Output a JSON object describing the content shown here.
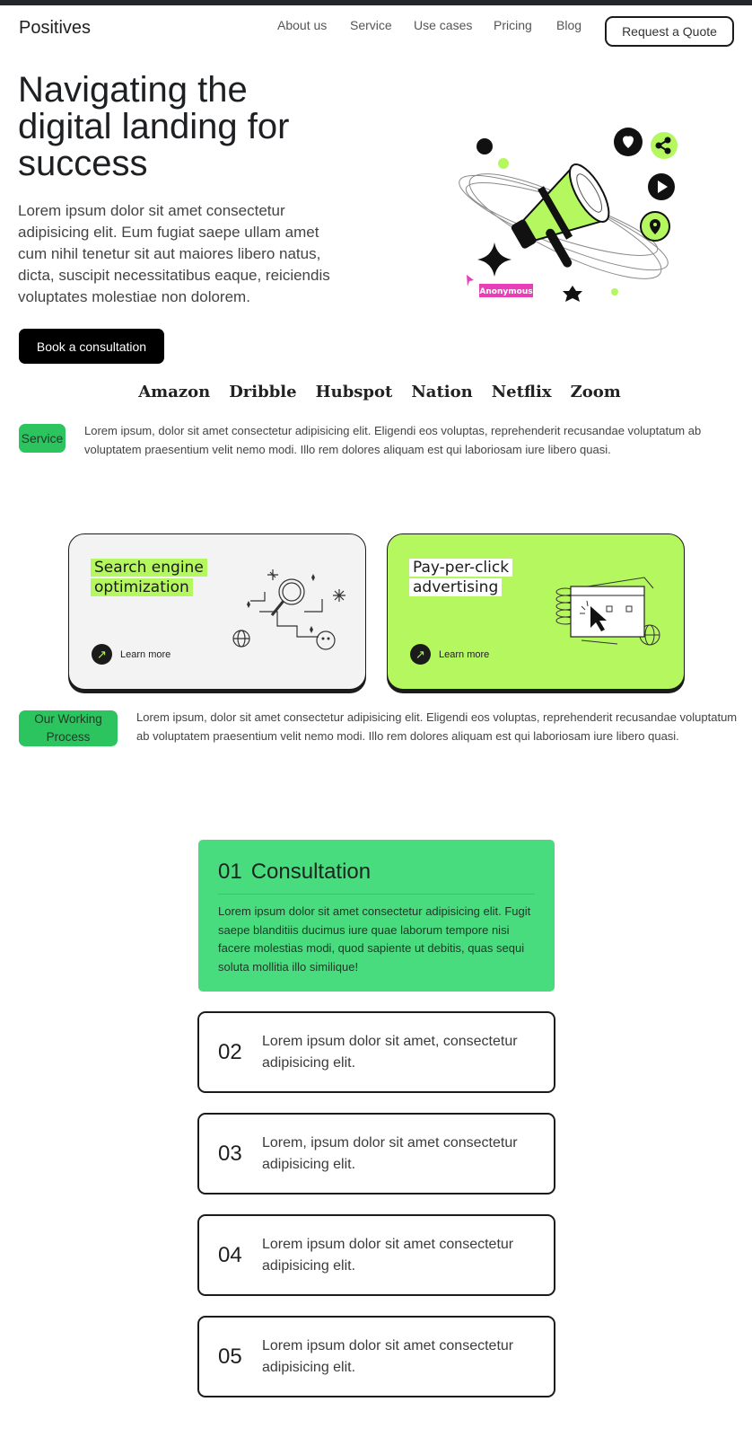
{
  "header": {
    "logo": "Positives",
    "nav": [
      "About us",
      "Service",
      "Use cases",
      "Pricing",
      "Blog"
    ],
    "cta": "Request a Quote"
  },
  "hero": {
    "title": "Navigating the digital landing for success",
    "text": "Lorem ipsum dolor sit amet consectetur adipisicing elit. Eum fugiat saepe ullam amet cum nihil tenetur sit aut maiores libero natus, dicta, suscipit necessitatibus eaque, reiciendis voluptates molestiae non dolorem.",
    "button": "Book a consultation",
    "illustration_tag": "Anonymous"
  },
  "brands": [
    "Amazon",
    "Dribble",
    "Hubspot",
    "Nation",
    "Netflix",
    "Zoom"
  ],
  "service": {
    "tag": "Service",
    "text": "Lorem ipsum, dolor sit amet consectetur adipisicing elit. Eligendi eos voluptas, reprehenderit recusandae voluptatum ab voluptatem praesentium velit nemo modi. Illo rem dolores aliquam est qui laboriosam iure libero quasi.",
    "cards": [
      {
        "title_line1": "Search engine",
        "title_line2": "optimization",
        "link": "Learn more",
        "bg": "#f3f3f3",
        "highlight": "#b5f75e"
      },
      {
        "title_line1": "Pay-per-click",
        "title_line2": "advertising",
        "link": "Learn more",
        "bg": "#b5f75e",
        "highlight": "#ffffff"
      }
    ]
  },
  "process": {
    "tag": "Our Working Process",
    "text": "Lorem ipsum, dolor sit amet consectetur adipisicing elit. Eligendi eos voluptas, reprehenderit recusandae voluptatum ab voluptatem praesentium velit nemo modi. Illo rem dolores aliquam est qui laboriosam iure libero quasi.",
    "first": {
      "num": "01",
      "title": "Consultation",
      "text": "Lorem ipsum dolor sit amet consectetur adipisicing elit. Fugit saepe blanditiis ducimus iure quae laborum tempore nisi facere molestias modi, quod sapiente ut debitis, quas sequi soluta mollitia illo similique!"
    },
    "steps": [
      {
        "num": "02",
        "text": "Lorem ipsum dolor sit amet, consectetur adipisicing elit."
      },
      {
        "num": "03",
        "text": "Lorem, ipsum dolor sit amet consectetur adipisicing elit."
      },
      {
        "num": "04",
        "text": "Lorem ipsum dolor sit amet consectetur adipisicing elit."
      },
      {
        "num": "05",
        "text": "Lorem ipsum dolor sit amet consectetur adipisicing elit."
      }
    ]
  },
  "colors": {
    "accent_lime": "#b5f75e",
    "accent_green": "#49dc7e",
    "tag_green": "#2bc45e",
    "dark": "#1b1b1b",
    "tag_pink": "#e83fb8"
  }
}
